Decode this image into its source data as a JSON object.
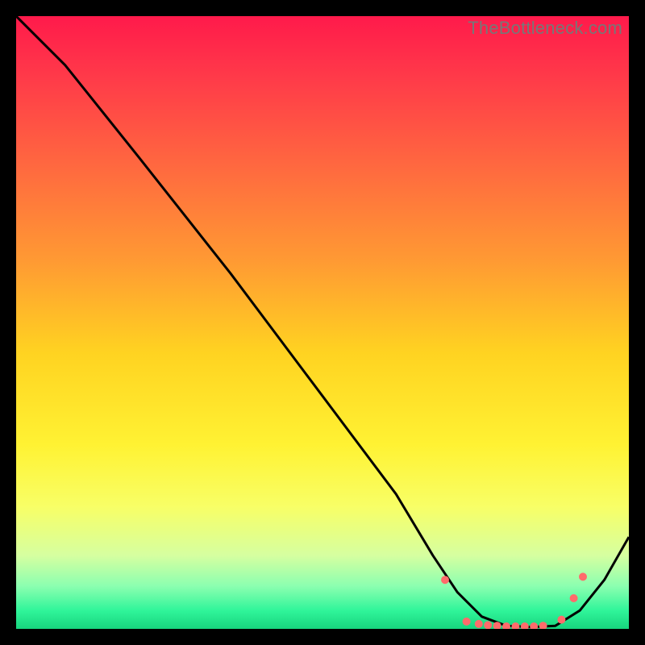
{
  "watermark": "TheBottleneck.com",
  "chart_data": {
    "type": "line",
    "title": "",
    "xlabel": "",
    "ylabel": "",
    "xlim": [
      0,
      100
    ],
    "ylim": [
      0,
      100
    ],
    "background_gradient": {
      "stops": [
        {
          "offset": 0.0,
          "color": "#ff1a4b"
        },
        {
          "offset": 0.1,
          "color": "#ff3a49"
        },
        {
          "offset": 0.25,
          "color": "#ff6a3f"
        },
        {
          "offset": 0.4,
          "color": "#ff9a33"
        },
        {
          "offset": 0.55,
          "color": "#ffd321"
        },
        {
          "offset": 0.7,
          "color": "#fff233"
        },
        {
          "offset": 0.8,
          "color": "#f8ff66"
        },
        {
          "offset": 0.88,
          "color": "#d6ffa0"
        },
        {
          "offset": 0.93,
          "color": "#8cffb0"
        },
        {
          "offset": 0.97,
          "color": "#30f59a"
        },
        {
          "offset": 1.0,
          "color": "#17d47e"
        }
      ]
    },
    "series": [
      {
        "name": "bottleneck-curve",
        "color": "#000000",
        "x": [
          0,
          3,
          8,
          20,
          35,
          50,
          62,
          68,
          72,
          76,
          80,
          84,
          88,
          92,
          96,
          100
        ],
        "y": [
          100,
          97,
          92,
          77,
          58,
          38,
          22,
          12,
          6,
          2,
          0.5,
          0.3,
          0.5,
          3,
          8,
          15
        ]
      }
    ],
    "markers": {
      "name": "optimal-range-dots",
      "color": "#ff6b6b",
      "radius": 5,
      "x": [
        70,
        73.5,
        75.5,
        77,
        78.5,
        80,
        81.5,
        83,
        84.5,
        86,
        89,
        91,
        92.5
      ],
      "y": [
        8,
        1.2,
        0.8,
        0.6,
        0.5,
        0.4,
        0.4,
        0.4,
        0.4,
        0.5,
        1.5,
        5,
        8.5
      ]
    }
  }
}
